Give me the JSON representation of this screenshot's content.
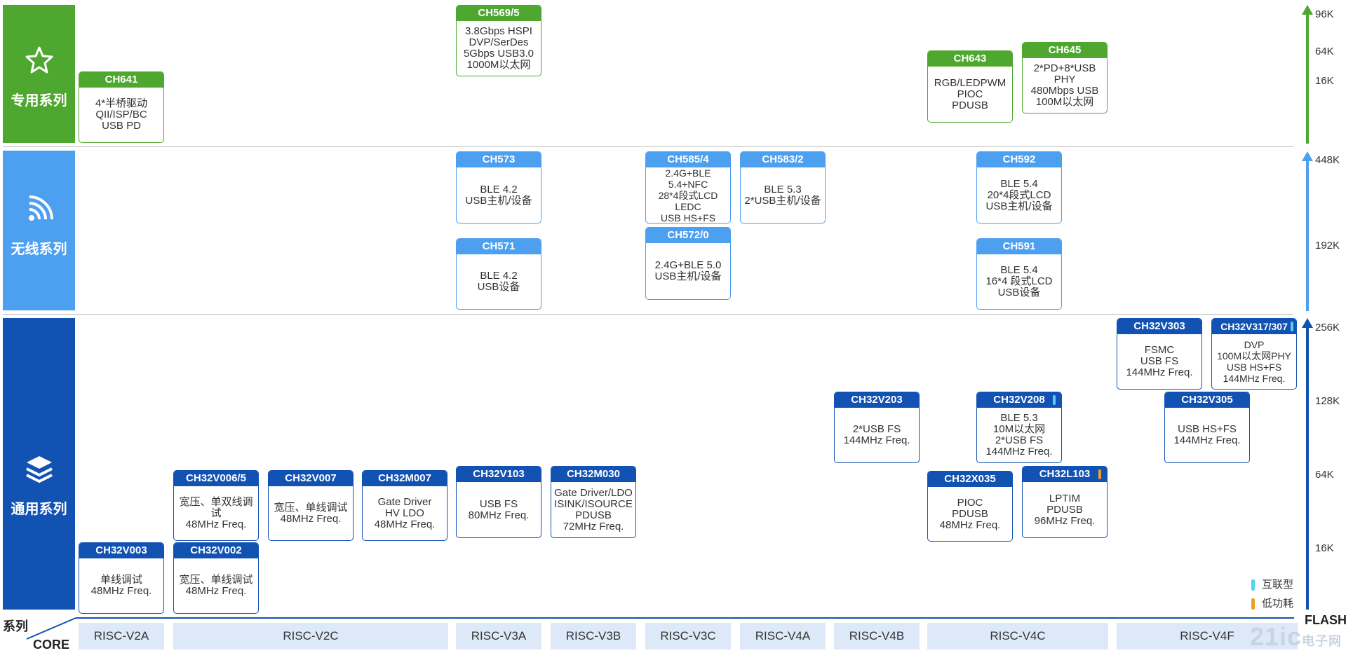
{
  "bands": {
    "special": {
      "label": "专用系列",
      "color": "#4ea72e"
    },
    "wireless": {
      "label": "无线系列",
      "color": "#4d9ff0"
    },
    "general": {
      "label": "通用系列",
      "color": "#1252b3"
    }
  },
  "cards": [
    {
      "id": "CH569/5",
      "band": "special",
      "lines": [
        "3.8Gbps HSPI",
        "DVP/SerDes",
        "5Gbps USB3.0",
        "1000M以太网"
      ]
    },
    {
      "id": "CH641",
      "band": "special",
      "lines": [
        "4*半桥驱动",
        "QII/ISP/BC",
        "USB PD"
      ]
    },
    {
      "id": "CH643",
      "band": "special",
      "lines": [
        "RGB/LEDPWM",
        "PIOC",
        "PDUSB"
      ]
    },
    {
      "id": "CH645",
      "band": "special",
      "lines": [
        "2*PD+8*USB PHY",
        "480Mbps USB",
        "100M以太网"
      ]
    },
    {
      "id": "CH573",
      "band": "wireless",
      "lines": [
        "BLE 4.2",
        "USB主机/设备"
      ]
    },
    {
      "id": "CH571",
      "band": "wireless",
      "lines": [
        "BLE 4.2",
        "USB设备"
      ]
    },
    {
      "id": "CH585/4",
      "band": "wireless",
      "lines": [
        "2.4G+BLE 5.4+NFC",
        "28*4段式LCD",
        "LEDC",
        "USB HS+FS"
      ]
    },
    {
      "id": "CH572/0",
      "band": "wireless",
      "lines": [
        "2.4G+BLE 5.0",
        "USB主机/设备"
      ]
    },
    {
      "id": "CH583/2",
      "band": "wireless",
      "lines": [
        "BLE 5.3",
        "2*USB主机/设备"
      ]
    },
    {
      "id": "CH592",
      "band": "wireless",
      "lines": [
        "BLE 5.4",
        "20*4段式LCD",
        "USB主机/设备"
      ]
    },
    {
      "id": "CH591",
      "band": "wireless",
      "lines": [
        "BLE 5.4",
        "16*4 段式LCD",
        "USB设备"
      ]
    },
    {
      "id": "CH32V003",
      "band": "general",
      "lines": [
        "单线调试",
        "48MHz Freq."
      ]
    },
    {
      "id": "CH32V006/5",
      "band": "general",
      "lines": [
        "宽压、单双线调试",
        "48MHz Freq."
      ]
    },
    {
      "id": "CH32V002",
      "band": "general",
      "lines": [
        "宽压、单线调试",
        "48MHz Freq."
      ]
    },
    {
      "id": "CH32V007",
      "band": "general",
      "lines": [
        "宽压、单线调试",
        "48MHz Freq."
      ]
    },
    {
      "id": "CH32M007",
      "band": "general",
      "lines": [
        "Gate Driver",
        "HV LDO",
        "48MHz Freq."
      ]
    },
    {
      "id": "CH32V103",
      "band": "general",
      "lines": [
        "USB FS",
        "80MHz Freq."
      ]
    },
    {
      "id": "CH32M030",
      "band": "general",
      "lines": [
        "Gate Driver/LDO",
        "ISINK/ISOURCE",
        "PDUSB",
        "72MHz Freq."
      ]
    },
    {
      "id": "CH32V203",
      "band": "general",
      "lines": [
        "2*USB FS",
        "144MHz Freq."
      ]
    },
    {
      "id": "CH32V208",
      "band": "general",
      "tag": "interconnect",
      "lines": [
        "BLE 5.3",
        "10M以太网",
        "2*USB FS",
        "144MHz Freq."
      ]
    },
    {
      "id": "CH32X035",
      "band": "general",
      "lines": [
        "PIOC",
        "PDUSB",
        "48MHz Freq."
      ]
    },
    {
      "id": "CH32L103",
      "band": "general",
      "tag": "lowpower",
      "lines": [
        "LPTIM",
        "PDUSB",
        "96MHz Freq."
      ]
    },
    {
      "id": "CH32V303",
      "band": "general",
      "lines": [
        "FSMC",
        "USB FS",
        "144MHz Freq."
      ]
    },
    {
      "id": "CH32V317/307",
      "band": "general",
      "tag": "interconnect",
      "lines": [
        "DVP",
        "100M以太网PHY",
        "USB HS+FS",
        "144MHz Freq."
      ]
    },
    {
      "id": "CH32V305",
      "band": "general",
      "lines": [
        "USB HS+FS",
        "144MHz Freq."
      ]
    }
  ],
  "cores": [
    "RISC-V2A",
    "RISC-V2C",
    "RISC-V3A",
    "RISC-V3B",
    "RISC-V3C",
    "RISC-V4A",
    "RISC-V4B",
    "RISC-V4C",
    "RISC-V4F"
  ],
  "flash_ticks": {
    "special": [
      "96K",
      "64K",
      "16K"
    ],
    "wireless": [
      "448K",
      "192K"
    ],
    "general": [
      "256K",
      "128K",
      "64K",
      "16K"
    ]
  },
  "legend": [
    {
      "label": "互联型",
      "color": "#55d0f0"
    },
    {
      "label": "低功耗",
      "color": "#f0a020"
    }
  ],
  "corner": {
    "series": "系列",
    "core": "CORE"
  },
  "axis_title": "FLASH",
  "watermark": {
    "main": "21ic",
    "sub": "电子网"
  }
}
